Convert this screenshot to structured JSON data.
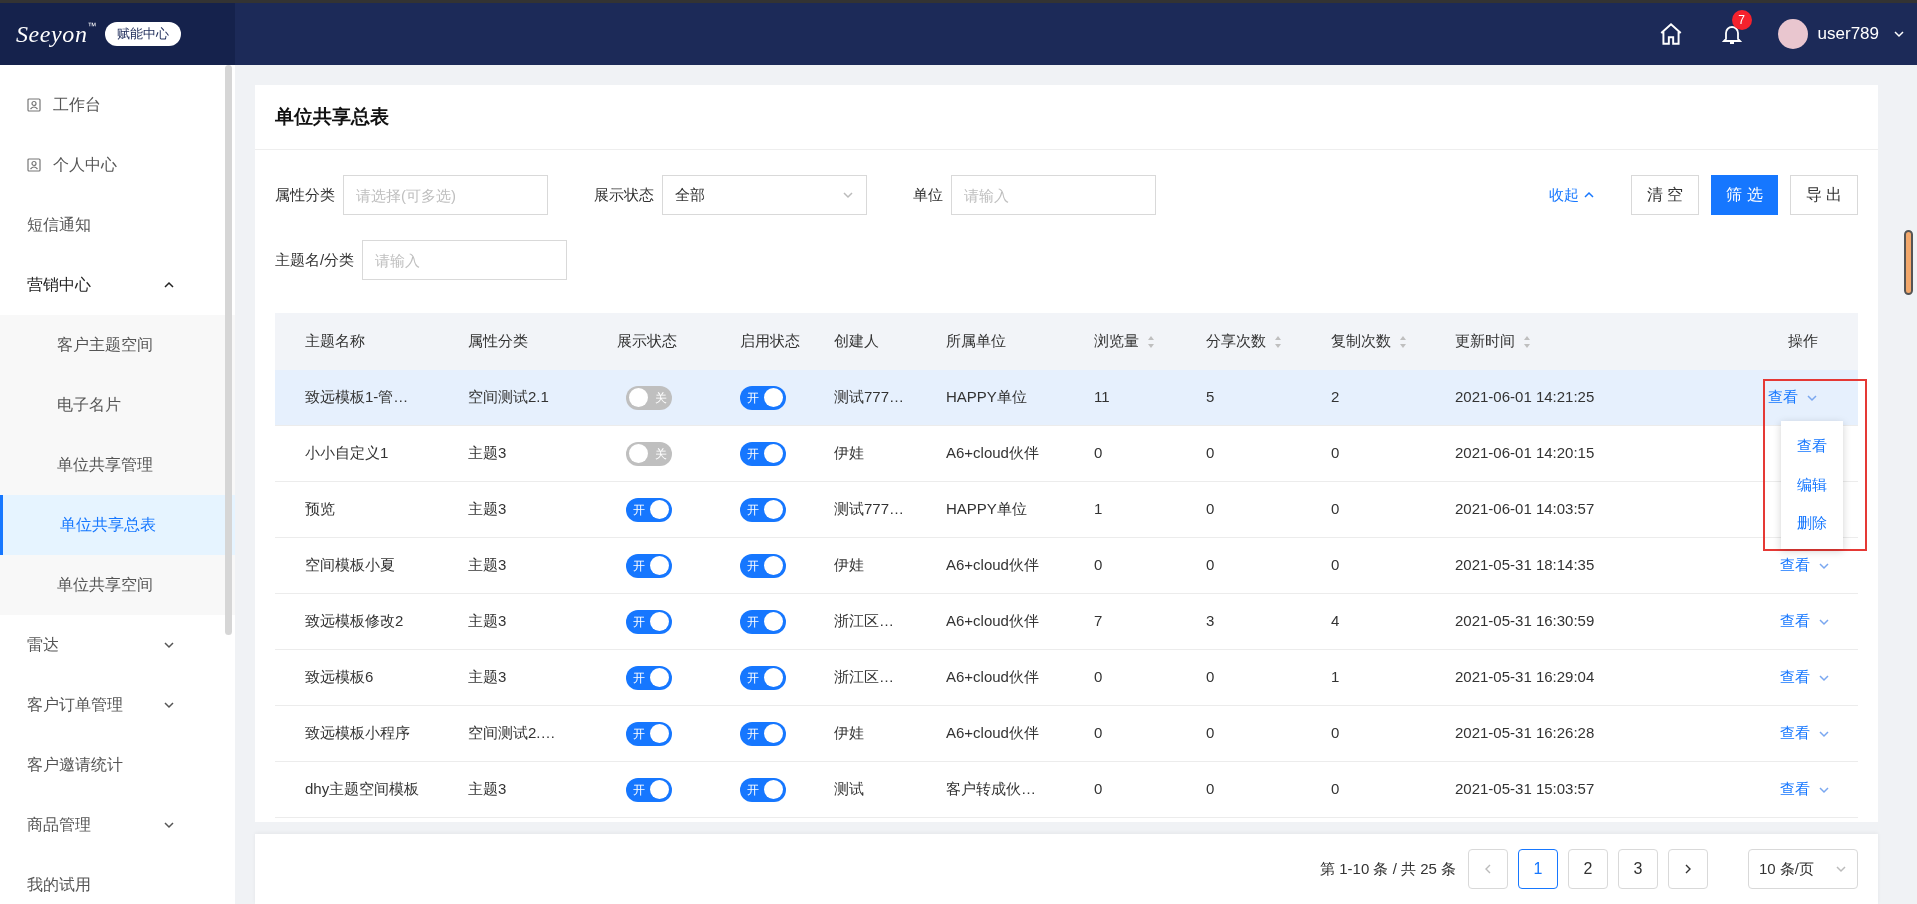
{
  "header": {
    "logo": "Seeyon",
    "logo_mark": "™",
    "product": "赋能中心",
    "notifications": "7",
    "user": "user789"
  },
  "sidebar": {
    "items": [
      {
        "kind": "icon-link",
        "label": "工作台",
        "selected": false
      },
      {
        "kind": "icon-link",
        "label": "个人中心",
        "selected": false
      },
      {
        "kind": "link",
        "label": "短信通知",
        "selected": false
      },
      {
        "kind": "group",
        "label": "营销中心",
        "expanded": true,
        "children": [
          {
            "label": "客户主题空间",
            "selected": false
          },
          {
            "label": "电子名片",
            "selected": false
          },
          {
            "label": "单位共享管理",
            "selected": false
          },
          {
            "label": "单位共享总表",
            "selected": true
          },
          {
            "label": "单位共享空间",
            "selected": false
          }
        ]
      },
      {
        "kind": "group",
        "label": "雷达",
        "expanded": false
      },
      {
        "kind": "group",
        "label": "客户订单管理",
        "expanded": false
      },
      {
        "kind": "link",
        "label": "客户邀请统计",
        "selected": false
      },
      {
        "kind": "group",
        "label": "商品管理",
        "expanded": false
      },
      {
        "kind": "link",
        "label": "我的试用",
        "selected": false
      }
    ]
  },
  "page": {
    "title": "单位共享总表"
  },
  "filters": {
    "fields": [
      {
        "kind": "input",
        "label": "属性分类",
        "placeholder": "请选择(可多选)"
      },
      {
        "kind": "select",
        "label": "展示状态",
        "value": "全部"
      },
      {
        "kind": "input",
        "label": "单位",
        "placeholder": "请输入"
      },
      {
        "kind": "input",
        "label": "主题名/分类",
        "placeholder": "请输入"
      }
    ],
    "collapse": "收起",
    "buttons": [
      {
        "label": "清 空",
        "primary": false
      },
      {
        "label": "筛 选",
        "primary": true
      },
      {
        "label": "导 出",
        "primary": false
      }
    ]
  },
  "table": {
    "columns": [
      {
        "label": "主题名称",
        "sortable": false
      },
      {
        "label": "属性分类",
        "sortable": false
      },
      {
        "label": "展示状态",
        "sortable": false
      },
      {
        "label": "启用状态",
        "sortable": false
      },
      {
        "label": "创建人",
        "sortable": false
      },
      {
        "label": "所属单位",
        "sortable": false
      },
      {
        "label": "浏览量",
        "sortable": true
      },
      {
        "label": "分享次数",
        "sortable": true
      },
      {
        "label": "复制次数",
        "sortable": true
      },
      {
        "label": "更新时间",
        "sortable": true
      },
      {
        "label": "操作",
        "sortable": false
      }
    ],
    "rows": [
      {
        "selected": true,
        "name": "致远模板1-管…",
        "category": "空间测试2.1",
        "display": {
          "on": false,
          "label": "关"
        },
        "enabled": {
          "on": true,
          "label": "开"
        },
        "creator": "测试777…",
        "unit": "HAPPY单位",
        "views": "11",
        "shares": "5",
        "copies": "2",
        "updated": "2021-06-01 14:21:25",
        "action": "查看",
        "menu_open": true
      },
      {
        "selected": false,
        "name": "小小自定义1",
        "category": "主题3",
        "display": {
          "on": false,
          "label": "关"
        },
        "enabled": {
          "on": true,
          "label": "开"
        },
        "creator": "伊娃",
        "unit": "A6+cloud伙伴",
        "views": "0",
        "shares": "0",
        "copies": "0",
        "updated": "2021-06-01 14:20:15",
        "menu_open": false
      },
      {
        "selected": false,
        "name": "预览",
        "category": "主题3",
        "display": {
          "on": true,
          "label": "开"
        },
        "enabled": {
          "on": true,
          "label": "开"
        },
        "creator": "测试777…",
        "unit": "HAPPY单位",
        "views": "1",
        "shares": "0",
        "copies": "0",
        "updated": "2021-06-01 14:03:57",
        "menu_open": false
      },
      {
        "selected": false,
        "name": "空间模板小夏",
        "category": "主题3",
        "display": {
          "on": true,
          "label": "开"
        },
        "enabled": {
          "on": true,
          "label": "开"
        },
        "creator": "伊娃",
        "unit": "A6+cloud伙伴",
        "views": "0",
        "shares": "0",
        "copies": "0",
        "updated": "2021-05-31 18:14:35",
        "action": "查看",
        "menu_open": false
      },
      {
        "selected": false,
        "name": "致远模板修改2",
        "category": "主题3",
        "display": {
          "on": true,
          "label": "开"
        },
        "enabled": {
          "on": true,
          "label": "开"
        },
        "creator": "浙江区…",
        "unit": "A6+cloud伙伴",
        "views": "7",
        "shares": "3",
        "copies": "4",
        "updated": "2021-05-31 16:30:59",
        "action": "查看",
        "menu_open": false
      },
      {
        "selected": false,
        "name": "致远模板6",
        "category": "主题3",
        "display": {
          "on": true,
          "label": "开"
        },
        "enabled": {
          "on": true,
          "label": "开"
        },
        "creator": "浙江区…",
        "unit": "A6+cloud伙伴",
        "views": "0",
        "shares": "0",
        "copies": "1",
        "updated": "2021-05-31 16:29:04",
        "action": "查看",
        "menu_open": false
      },
      {
        "selected": false,
        "name": "致远模板小程序",
        "category": "空间测试2.…",
        "display": {
          "on": true,
          "label": "开"
        },
        "enabled": {
          "on": true,
          "label": "开"
        },
        "creator": "伊娃",
        "unit": "A6+cloud伙伴",
        "views": "0",
        "shares": "0",
        "copies": "0",
        "updated": "2021-05-31 16:26:28",
        "action": "查看",
        "menu_open": false
      },
      {
        "selected": false,
        "name": "dhy主题空间模板",
        "category": "主题3",
        "display": {
          "on": true,
          "label": "开"
        },
        "enabled": {
          "on": true,
          "label": "开"
        },
        "creator": "测试",
        "unit": "客户转成伙…",
        "views": "0",
        "shares": "0",
        "copies": "0",
        "updated": "2021-05-31 15:03:57",
        "action": "查看",
        "menu_open": false
      }
    ],
    "action_menu": [
      "查看",
      "编辑",
      "删除"
    ]
  },
  "pagination": {
    "summary": "第 1-10 条 / 共 25 条",
    "pages": [
      {
        "label": "1",
        "selected": true
      },
      {
        "label": "2",
        "selected": false
      },
      {
        "label": "3",
        "selected": false
      }
    ],
    "page_size": "10 条/页"
  }
}
